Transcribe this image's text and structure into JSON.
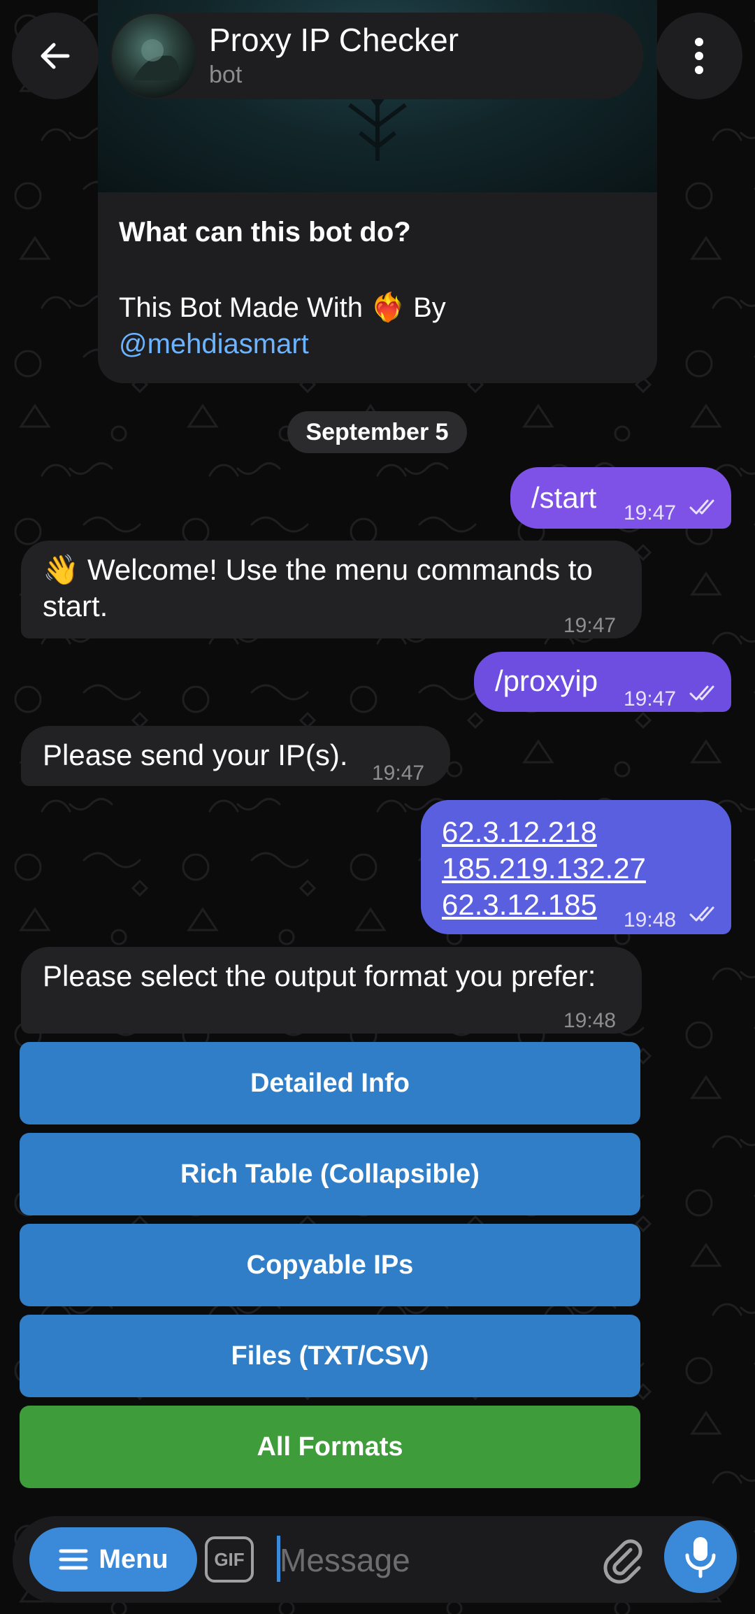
{
  "header": {
    "title": "Proxy IP Checker",
    "subtitle": "bot",
    "back_icon": "arrow-left-icon",
    "more_icon": "more-vertical-icon"
  },
  "intro": {
    "heading": "What can this bot do?",
    "body_prefix": "This Bot Made With",
    "body_emoji": "❤️‍🔥",
    "body_suffix": "By",
    "link": "@mehdiasmart"
  },
  "date_separator": "September 5",
  "messages": [
    {
      "dir": "out",
      "text": "/start",
      "time": "19:47",
      "status": "read"
    },
    {
      "dir": "in",
      "line1": "👋 Welcome! Use the menu commands to",
      "line2": "start.",
      "time": "19:47"
    },
    {
      "dir": "out",
      "text": "/proxyip",
      "time": "19:47",
      "status": "read"
    },
    {
      "dir": "in",
      "text": "Please send your IP(s).",
      "time": "19:47"
    },
    {
      "dir": "out",
      "ips": [
        "62.3.12.218",
        "185.219.132.27",
        "62.3.12.185"
      ],
      "time": "19:48",
      "status": "read"
    },
    {
      "dir": "in",
      "text": "Please select the output format you prefer:",
      "time": "19:48"
    }
  ],
  "keyboard": [
    {
      "label": "Detailed Info",
      "color": "#2f7ec7"
    },
    {
      "label": "Rich Table (Collapsible)",
      "color": "#2f7ec7"
    },
    {
      "label": "Copyable IPs",
      "color": "#2f7ec7"
    },
    {
      "label": "Files (TXT/CSV)",
      "color": "#2f7ec7"
    },
    {
      "label": "All Formats",
      "color": "#3e9c3b"
    }
  ],
  "composer": {
    "menu_label": "Menu",
    "gif_label": "GIF",
    "placeholder": "Message",
    "attach_icon": "paperclip-icon",
    "mic_icon": "microphone-icon"
  },
  "colors": {
    "accent": "#3a8ad9",
    "outgoing_bubble": "#7e52e6",
    "incoming_bubble": "#222224",
    "link": "#6cb4ff"
  }
}
